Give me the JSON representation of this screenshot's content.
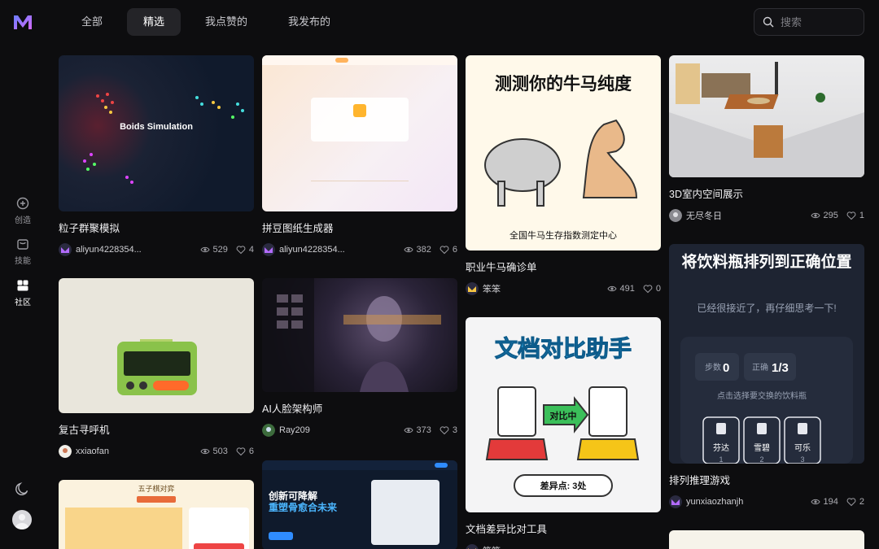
{
  "app": {
    "logo_icon": "jm-logo-icon",
    "accent": "#8a5cf6"
  },
  "sidebar": {
    "items": [
      {
        "label": "创造",
        "icon": "plus-circle-icon"
      },
      {
        "label": "技能",
        "icon": "bag-icon"
      },
      {
        "label": "社区",
        "icon": "grid-icon"
      }
    ],
    "theme_icon": "moon-icon",
    "avatar_icon": "user-avatar-icon"
  },
  "tabs": [
    {
      "label": "全部"
    },
    {
      "label": "精选"
    },
    {
      "label": "我点赞的"
    },
    {
      "label": "我发布的"
    }
  ],
  "active_tab": "精选",
  "search": {
    "placeholder": "搜索"
  },
  "cards": [
    {
      "title": "粒子群聚模拟",
      "author": "aliyun4228354...",
      "views": "529",
      "likes": "4",
      "thumb_text": "Boids Simulation"
    },
    {
      "title": "拼豆图纸生成器",
      "author": "aliyun4228354...",
      "views": "382",
      "likes": "6"
    },
    {
      "title": "职业牛马确诊单",
      "author": "笨笨",
      "views": "491",
      "likes": "0",
      "thumb_text": "测测你的牛马纯度",
      "thumb_sub": "全国牛马生存指数测定中心"
    },
    {
      "title": "3D室内空间展示",
      "author": "无尽冬日",
      "views": "295",
      "likes": "1"
    },
    {
      "title": "复古寻呼机",
      "author": "xxiaofan",
      "views": "503",
      "likes": "6"
    },
    {
      "title": "AI人脸架构师",
      "author": "Ray209",
      "views": "373",
      "likes": "3"
    },
    {
      "title": "文档差异比对工具",
      "author": "笨笨",
      "views": "",
      "likes": "",
      "thumb_text": "文档对比助手",
      "thumb_mid": "对比中",
      "thumb_sub": "差异点: 3处"
    },
    {
      "title": "排列推理游戏",
      "author": "yunxiaozhanjh",
      "views": "194",
      "likes": "2",
      "thumb_text": "将饮料瓶排列到正确位置",
      "thumb_hint": "已经很接近了，再仔细思考一下!",
      "steps_label": "步数",
      "steps": "0",
      "correct_label": "正确",
      "correct": "1/3",
      "tap_hint": "点击选择要交换的饮料瓶",
      "bottles": [
        {
          "name": "芬达",
          "n": "1"
        },
        {
          "name": "雪碧",
          "n": "2"
        },
        {
          "name": "可乐",
          "n": "3"
        }
      ]
    },
    {
      "title": "",
      "thumb_text": "五子棋对弈"
    },
    {
      "title": "",
      "thumb_text": "创新可降解",
      "thumb_sub": "重塑骨愈合未来"
    }
  ]
}
